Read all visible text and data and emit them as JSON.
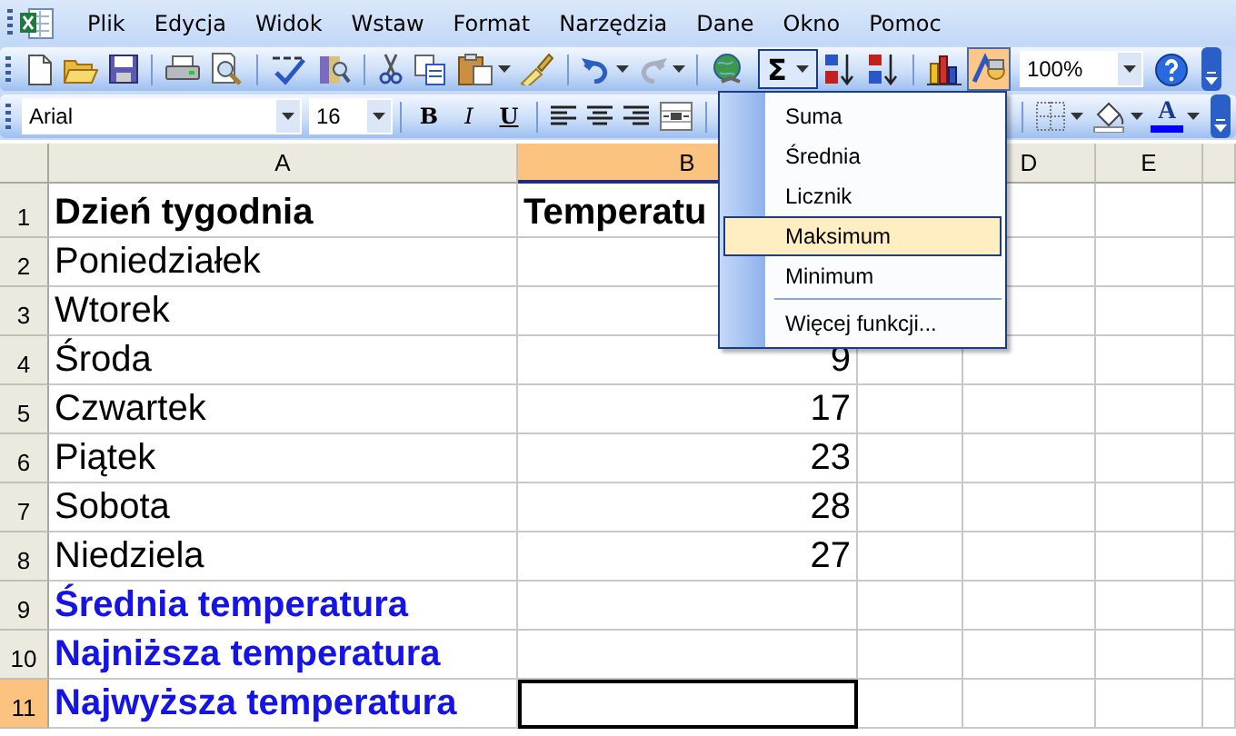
{
  "menu_bar": {
    "items": [
      "Plik",
      "Edycja",
      "Widok",
      "Wstaw",
      "Format",
      "Narzędzia",
      "Dane",
      "Okno",
      "Pomoc"
    ]
  },
  "standard_toolbar": {
    "autosum": {
      "label": "Σ",
      "pressed": true
    },
    "drawing_active": true,
    "zoom": "100%"
  },
  "formatting_toolbar": {
    "font": "Arial",
    "size": "16",
    "bold": "B",
    "italic": "I",
    "underline": "U",
    "font_color": {
      "glyph": "A",
      "color": "#0000ff"
    }
  },
  "columns": [
    {
      "label": "A",
      "selected": false
    },
    {
      "label": "B",
      "selected": true
    },
    {
      "label": "D",
      "selected": false
    },
    {
      "label": "E",
      "selected": false
    }
  ],
  "rows": [
    {
      "number": "1",
      "selected": false,
      "kind": "header",
      "a": "Dzień tygodnia",
      "b": "Temperatu"
    },
    {
      "number": "2",
      "selected": false,
      "kind": "normal",
      "a": "Poniedziałek"
    },
    {
      "number": "3",
      "selected": false,
      "kind": "normal",
      "a": "Wtorek"
    },
    {
      "number": "4",
      "selected": false,
      "kind": "normal",
      "a": "Środa",
      "b": "9"
    },
    {
      "number": "5",
      "selected": false,
      "kind": "normal",
      "a": "Czwartek",
      "b": "17"
    },
    {
      "number": "6",
      "selected": false,
      "kind": "normal",
      "a": "Piątek",
      "b": "23"
    },
    {
      "number": "7",
      "selected": false,
      "kind": "normal",
      "a": "Sobota",
      "b": "28"
    },
    {
      "number": "8",
      "selected": false,
      "kind": "normal",
      "a": "Niedziela",
      "b": "27"
    },
    {
      "number": "9",
      "selected": false,
      "kind": "summary",
      "a": "Średnia temperatura"
    },
    {
      "number": "10",
      "selected": false,
      "kind": "summary",
      "a": "Najniższa temperatura"
    },
    {
      "number": "11",
      "selected": true,
      "kind": "summary",
      "a": "Najwyższa temperatura",
      "b_active": true
    }
  ],
  "autosum_menu": {
    "items": [
      {
        "label": "Suma",
        "selected": false
      },
      {
        "label": "Średnia",
        "selected": false
      },
      {
        "label": "Licznik",
        "selected": false
      },
      {
        "label": "Maksimum",
        "selected": true
      },
      {
        "label": "Minimum",
        "selected": false
      },
      {
        "label": "Więcej funkcji...",
        "selected": false,
        "separator_before": true
      }
    ]
  }
}
